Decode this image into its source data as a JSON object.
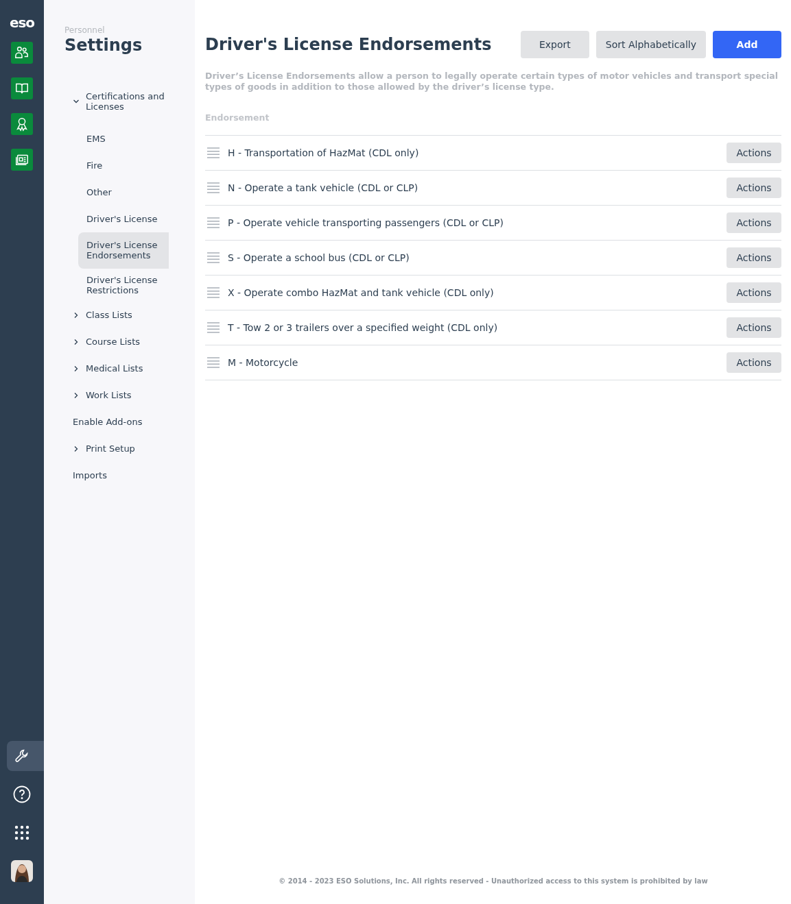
{
  "rail": {
    "logo": "eso",
    "apps": [
      {
        "kind": "people",
        "selected": false
      },
      {
        "kind": "book",
        "selected": false
      },
      {
        "kind": "award",
        "selected": false
      },
      {
        "kind": "news",
        "selected": false
      }
    ],
    "bottom": [
      {
        "kind": "tools",
        "selected": true
      },
      {
        "kind": "help",
        "selected": false
      },
      {
        "kind": "apps",
        "selected": false
      },
      {
        "kind": "avatar",
        "selected": false
      }
    ]
  },
  "sidebar": {
    "eyebrow": "Personnel",
    "title": "Settings",
    "items": [
      {
        "label": "Certifications and Licenses",
        "kind": "group",
        "expanded": true,
        "selected": false,
        "children": [
          {
            "label": "EMS",
            "selected": false
          },
          {
            "label": "Fire",
            "selected": false
          },
          {
            "label": "Other",
            "selected": false
          },
          {
            "label": "Driver's License",
            "selected": false
          },
          {
            "label": "Driver's License Endorsements",
            "selected": true
          },
          {
            "label": "Driver's License Restrictions",
            "selected": false
          }
        ]
      },
      {
        "label": "Class Lists",
        "kind": "group",
        "expanded": false,
        "selected": false
      },
      {
        "label": "Course Lists",
        "kind": "group",
        "expanded": false,
        "selected": false
      },
      {
        "label": "Medical Lists",
        "kind": "group",
        "expanded": false,
        "selected": false
      },
      {
        "label": "Work Lists",
        "kind": "group",
        "expanded": false,
        "selected": false
      },
      {
        "label": "Enable Add-ons",
        "kind": "link",
        "selected": false
      },
      {
        "label": "Print Setup",
        "kind": "group",
        "expanded": false,
        "selected": false
      },
      {
        "label": "Imports",
        "kind": "link",
        "selected": false
      }
    ]
  },
  "page": {
    "title": "Driver's License Endorsements",
    "buttons": [
      {
        "label": "Export",
        "kind": "secondary"
      },
      {
        "label": "Sort Alphabetically",
        "kind": "secondary"
      },
      {
        "label": "Add",
        "kind": "primary"
      }
    ],
    "description": "Driver’s License Endorsements allow a person to legally operate certain types of motor vehicles and transport special types of goods in addition to those allowed by the driver’s license type.",
    "table": {
      "columns": [
        "Endorsement"
      ],
      "rows": [
        {
          "name": "H - Transportation of HazMat (CDL only)",
          "action": "Actions"
        },
        {
          "name": "N - Operate a tank vehicle (CDL or CLP)",
          "action": "Actions"
        },
        {
          "name": "P - Operate vehicle transporting passengers (CDL or CLP)",
          "action": "Actions"
        },
        {
          "name": "S - Operate a school bus (CDL or CLP)",
          "action": "Actions"
        },
        {
          "name": "X - Operate combo HazMat and tank vehicle (CDL only)",
          "action": "Actions"
        },
        {
          "name": "T - Tow 2 or 3 trailers over a specified weight (CDL only)",
          "action": "Actions"
        },
        {
          "name": "M - Motorcycle",
          "action": "Actions"
        }
      ]
    }
  },
  "footer": "© 2014 - 2023 ESO Solutions, Inc. All rights reserved - Unauthorized access to this system is prohibited by law"
}
